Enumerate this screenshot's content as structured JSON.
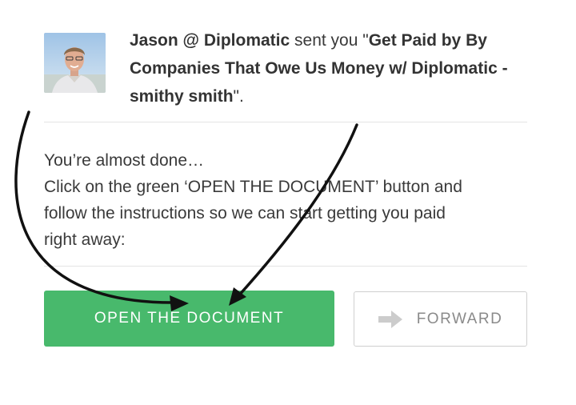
{
  "notification": {
    "sender": "Jason @ Diplomatic",
    "verb": " sent you \"",
    "document_title": "Get Paid by By Companies That Owe Us Money w/ Diplomatic - smithy smith",
    "end_punct": "\"."
  },
  "message": {
    "line1": "You’re almost done…",
    "line2": "Click on the green ‘OPEN THE DOCUMENT’ button and",
    "line3": "follow the instructions so we can start getting you paid",
    "line4": "right away:"
  },
  "buttons": {
    "open_label": "OPEN THE DOCUMENT",
    "forward_label": "FORWARD",
    "forward_icon": "arrow-right-icon"
  },
  "colors": {
    "primary_green": "#48b96c",
    "text": "#3a3a3a",
    "forward_text": "#8a8a8a",
    "annotation_arrow": "#111111"
  }
}
